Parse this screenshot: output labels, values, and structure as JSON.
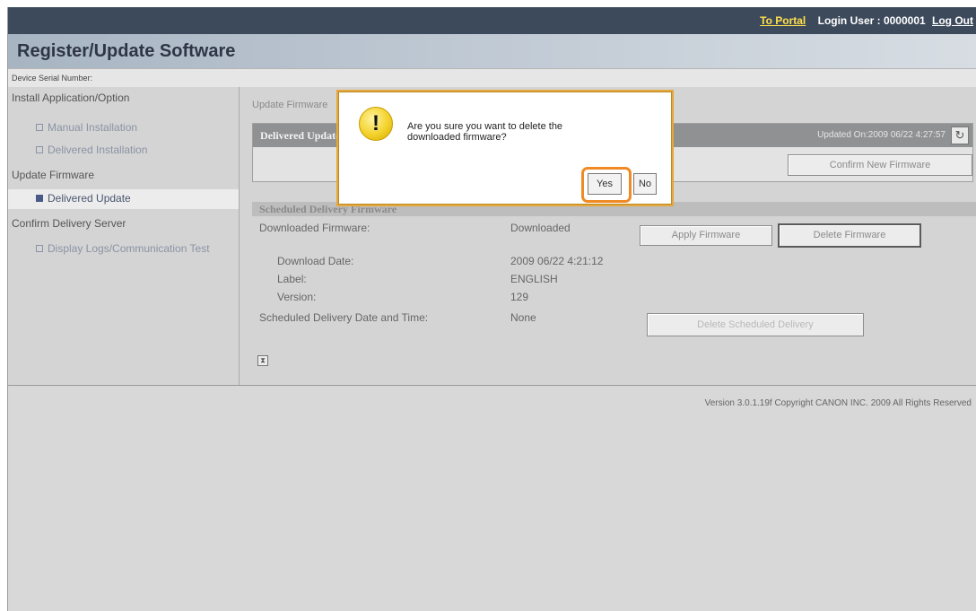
{
  "header": {
    "portal_link": "To Portal",
    "login_user": "Login User : 0000001",
    "logout_link": "Log Out",
    "title": "Register/Update Software"
  },
  "device": {
    "serial_label": "Device Serial Number:"
  },
  "sidebar": {
    "group1": "Install Application/Option",
    "manual_installation": "Manual Installation",
    "delivered_installation": "Delivered Installation",
    "group2": "Update Firmware",
    "delivered_update": "Delivered Update",
    "group3": "Confirm Delivery Server",
    "display_logs": "Display Logs/Communication Test"
  },
  "main": {
    "breadcrumb": "Update Firmware",
    "section_title": "Delivered Update",
    "updated_on": "Updated On:2009 06/22 4:27:57",
    "confirm_button": "Confirm New Firmware",
    "scheduled_title": "Scheduled Delivery Firmware",
    "downloaded_firmware_label": "Downloaded Firmware:",
    "downloaded_firmware_value": "Downloaded",
    "apply_button": "Apply Firmware",
    "delete_button": "Delete Firmware",
    "download_date_label": "Download Date:",
    "download_date_value": "2009 06/22 4:21:12",
    "label_label": "Label:",
    "label_value": "ENGLISH",
    "version_label": "Version:",
    "version_value": "129",
    "scheduled_date_label": "Scheduled Delivery Date and Time:",
    "scheduled_date_value": "None",
    "delete_scheduled_button": "Delete Scheduled Delivery"
  },
  "footer": {
    "copyright": "Version 3.0.1.19f Copyright CANON INC. 2009 All Rights Reserved"
  },
  "dialog": {
    "message_line1": "Are you sure you want to delete the",
    "message_line2": "downloaded firmware?",
    "yes": "Yes",
    "no": "No"
  },
  "colors": {
    "topbar": "#3d4a5c",
    "portal_link": "#ffe04a",
    "highlight": "#f08a24",
    "dialog_border": "#e6a73d"
  },
  "icons": {
    "warning": "warning-icon",
    "refresh": "refresh-icon",
    "page_nav": "page-nav-icon"
  }
}
